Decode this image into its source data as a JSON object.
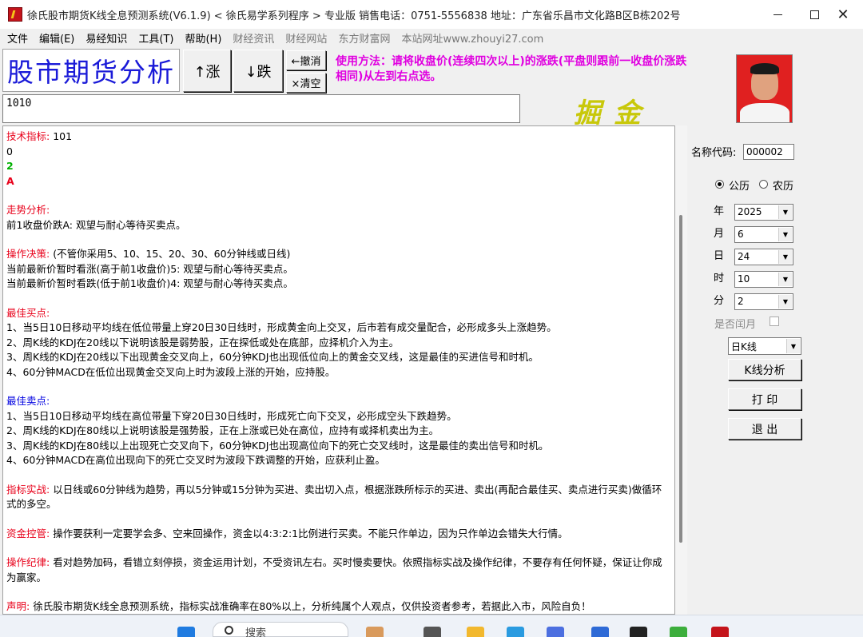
{
  "window": {
    "title": "徐氏股市期货K线全息预测系统(V6.1.9)  < 徐氏易学系列程序 > 专业版  销售电话：0751-5556838  地址：广东省乐昌市文化路B区B栋202号"
  },
  "menu": {
    "items": [
      "文件",
      "编辑(E)",
      "易经知识",
      "工具(T)",
      "帮助(H)",
      "财经资讯",
      "财经网站",
      "东方财富网",
      "本站网址www.zhouyi27.com"
    ]
  },
  "toolbar": {
    "big_title": "股市期货分析",
    "up_label": "↑涨",
    "down_label": "↓跌",
    "undo_label": "←撤消",
    "clear_label": "×清空",
    "usage": "使用方法：请将收盘价(连续四次以上)的涨跌(平盘则跟前一收盘价涨跌相同)从左到右点选。",
    "input_value": "1010",
    "slogan": "掘金"
  },
  "output": {
    "tech_label": "技术指标:",
    "tech_value": " 101",
    "line_0": "0",
    "line_2": "2",
    "line_A": "A",
    "trend_label": "走势分析:",
    "trend_text": "前1收盘价跌A: 观望与耐心等待买卖点。",
    "op_label": "操作决策:",
    "op_text": " (不管你采用5、10、15、20、30、60分钟线或日线)",
    "op_line1": "当前最新价暂时看涨(高于前1收盘价)5: 观望与耐心等待买卖点。",
    "op_line2": "当前最新价暂时看跌(低于前1收盘价)4: 观望与耐心等待买卖点。",
    "buy_label": "最佳买点:",
    "buy_lines": [
      "1、当5日10日移动平均线在低位带量上穿20日30日线时，形成黄金向上交叉，后市若有成交量配合，必形成多头上涨趋势。",
      "2、周K线的KDJ在20线以下说明该股是弱势股，正在探低或处在底部，应择机介入为主。",
      "3、周K线的KDJ在20线以下出现黄金交叉向上，60分钟KDJ也出现低位向上的黄金交叉线，这是最佳的买进信号和时机。",
      "4、60分钟MACD在低位出现黄金交叉向上时为波段上涨的开始，应持股。"
    ],
    "sell_label": "最佳卖点:",
    "sell_lines": [
      "1、当5日10日移动平均线在高位带量下穿20日30日线时，形成死亡向下交叉，必形成空头下跌趋势。",
      "2、周K线的KDJ在80线以上说明该股是强势股，正在上涨或已处在高位，应持有或择机卖出为主。",
      "3、周K线的KDJ在80线以上出现死亡交叉向下，60分钟KDJ也出现高位向下的死亡交叉线时，这是最佳的卖出信号和时机。",
      "4、60分钟MACD在高位出现向下的死亡交叉时为波段下跌调整的开始，应获利止盈。"
    ],
    "practice_label": "指标实战:",
    "practice_text": " 以日线或60分钟线为趋势，再以5分钟或15分钟为买进、卖出切入点，根据涨跌所标示的买进、卖出(再配合最佳买、卖点进行买卖)做循环式的多空。",
    "fund_label": "资金控管:",
    "fund_text": " 操作要获利一定要学会多、空来回操作，资金以4:3:2:1比例进行买卖。不能只作单边，因为只作单边会错失大行情。",
    "discipline_label": "操作纪律:",
    "discipline_text": " 看对趋势加码，看错立刻停损，资金运用计划，不受资讯左右。买时慢卖要快。依照指标实战及操作纪律，不要存有任何怀疑，保证让你成为赢家。",
    "statement_label": "声明:",
    "statement_text": " 徐氏股市期货K线全息预测系统，指标实战准确率在80%以上，分析纯属个人观点，仅供投资者参考，若据此入市，风险自负！"
  },
  "right": {
    "name_code_label": "名称代码:",
    "name_code_value": "000002",
    "solar_label": "公历",
    "lunar_label": "农历",
    "year_label": "年",
    "year_value": "2025",
    "month_label": "月",
    "month_value": "6",
    "day_label": "日",
    "day_value": "24",
    "hour_label": "时",
    "hour_value": "10",
    "minute_label": "分",
    "minute_value": "2",
    "leap_label": "是否闰月",
    "period_value": "日K线",
    "analyze_label": "K线分析",
    "print_label": "打 印",
    "exit_label": "退 出"
  },
  "taskbar": {
    "search_label": "搜索"
  },
  "colors": {
    "title_blue": "#1a1ad8",
    "usage_magenta": "#e000e0",
    "label_red": "#e8001a",
    "label_blue": "#0000e0",
    "slogan_yellow": "#c8c80a"
  }
}
